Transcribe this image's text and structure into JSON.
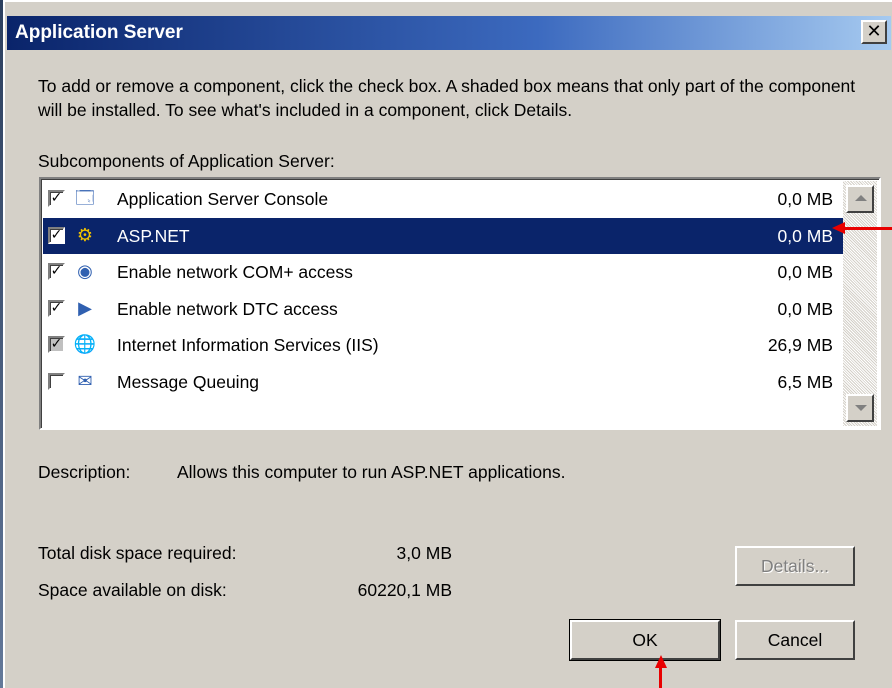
{
  "window": {
    "title": "Application Server",
    "close_glyph": "✕"
  },
  "instructions": "To add or remove a component, click the check box. A shaded box means that only part of the component will be installed. To see what's included in a component, click Details.",
  "list_label": "Subcomponents of Application Server:",
  "components": [
    {
      "name": "Application Server Console",
      "size": "0,0 MB",
      "checked": true,
      "selected": false,
      "icon": "console-icon",
      "glyph": "🗔"
    },
    {
      "name": "ASP.NET",
      "size": "0,0 MB",
      "checked": true,
      "selected": true,
      "icon": "gears-icon",
      "glyph": "⚙"
    },
    {
      "name": "Enable network COM+ access",
      "size": "0,0 MB",
      "checked": true,
      "selected": false,
      "icon": "com-plus-icon",
      "glyph": "◉"
    },
    {
      "name": "Enable network DTC access",
      "size": "0,0 MB",
      "checked": true,
      "selected": false,
      "icon": "dtc-icon",
      "glyph": "▶"
    },
    {
      "name": "Internet Information Services (IIS)",
      "size": "26,9 MB",
      "checked": true,
      "shaded": true,
      "selected": false,
      "icon": "iis-globe-icon",
      "glyph": "🌐"
    },
    {
      "name": "Message Queuing",
      "size": "6,5 MB",
      "checked": false,
      "selected": false,
      "icon": "message-queue-icon",
      "glyph": "✉"
    }
  ],
  "description": {
    "label": "Description:",
    "text": "Allows this computer to run ASP.NET applications."
  },
  "disk": {
    "required_label": "Total disk space required:",
    "required_value": "3,0 MB",
    "available_label": "Space available on disk:",
    "available_value": "60220,1 MB"
  },
  "buttons": {
    "details": "Details...",
    "ok": "OK",
    "cancel": "Cancel"
  },
  "colors": {
    "selection": "#0a246a",
    "dialog": "#d4d0c8",
    "annotation_arrow": "#e80000"
  }
}
